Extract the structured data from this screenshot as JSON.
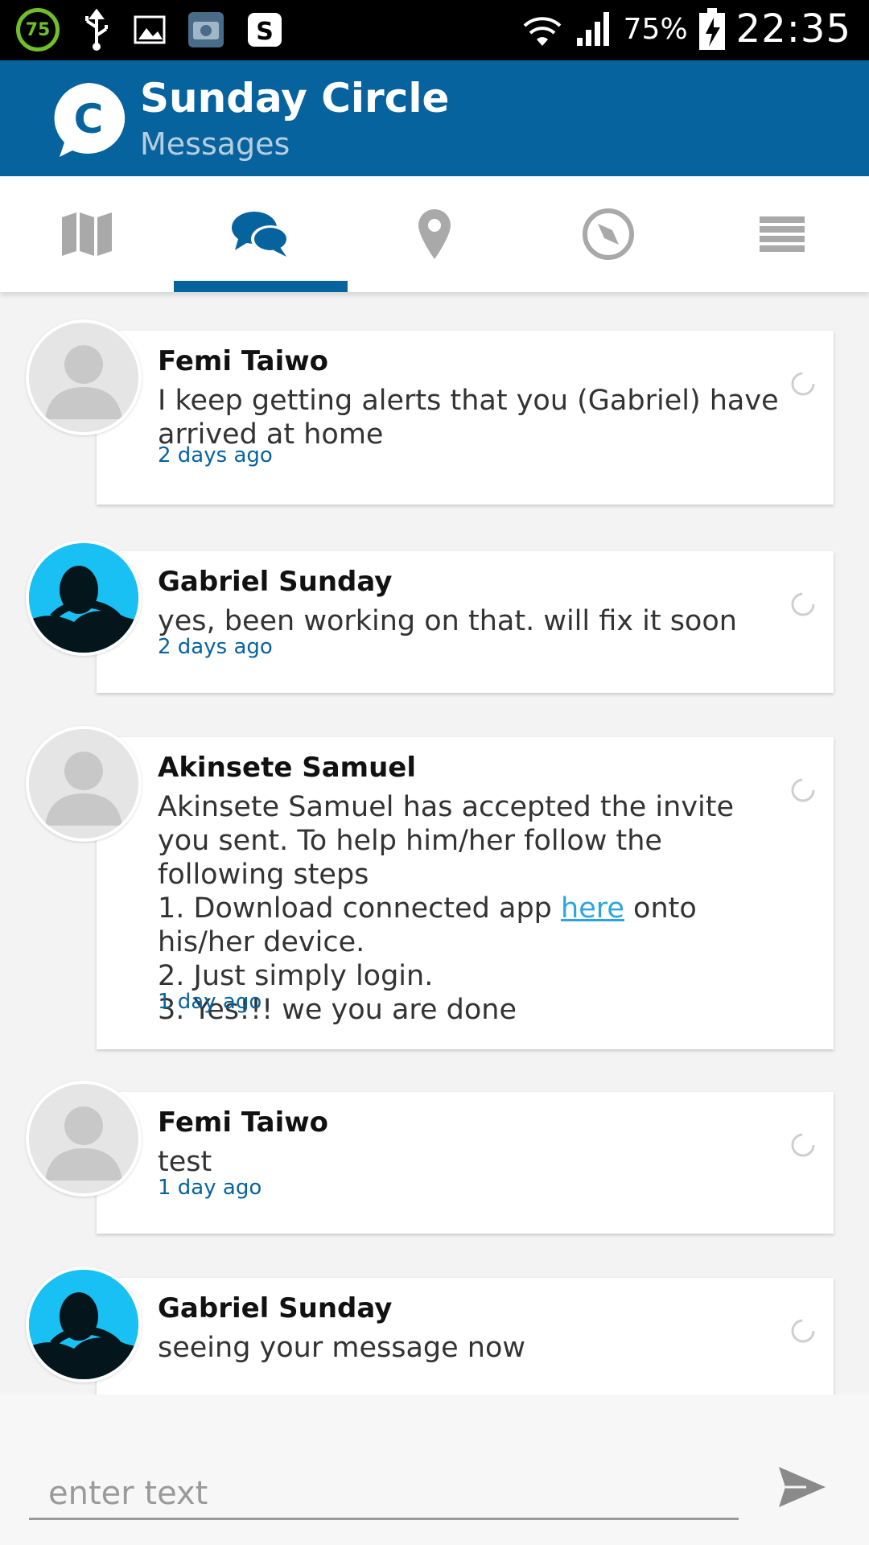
{
  "status_bar": {
    "battery_badge": "75",
    "battery_percent": "75%",
    "time": "22:35"
  },
  "header": {
    "logo_letter": "C",
    "title": "Sunday Circle",
    "subtitle": "Messages"
  },
  "tabs": [
    {
      "icon": "map-icon",
      "active": false
    },
    {
      "icon": "chat-icon",
      "active": true
    },
    {
      "icon": "location-pin-icon",
      "active": false
    },
    {
      "icon": "compass-icon",
      "active": false
    },
    {
      "icon": "menu-icon",
      "active": false
    }
  ],
  "messages": [
    {
      "sender": "Femi Taiwo",
      "body": "I keep getting alerts that you (Gabriel) have arrived at home",
      "time": "2 days ago",
      "avatar": "placeholder"
    },
    {
      "sender": "Gabriel Sunday",
      "body": "yes, been working on that. will fix it soon",
      "time": "2 days ago",
      "avatar": "photo"
    },
    {
      "sender": "Akinsete Samuel",
      "body_pre": "Akinsete Samuel has accepted the invite you sent. To help him/her follow the following steps\n1. Download connected app ",
      "body_link": "here",
      "body_post": " onto his/her device.\n2. Just simply login.\n3. Yes!!! we you are done",
      "time": "1 day ago",
      "avatar": "placeholder"
    },
    {
      "sender": "Femi Taiwo",
      "body": "test",
      "time": "1 day ago",
      "avatar": "placeholder"
    },
    {
      "sender": "Gabriel Sunday",
      "body": "seeing your message now",
      "time": "",
      "avatar": "photo"
    }
  ],
  "composer": {
    "placeholder": "enter text",
    "value": ""
  },
  "colors": {
    "brand": "#07639e",
    "link": "#2aa5e0"
  }
}
